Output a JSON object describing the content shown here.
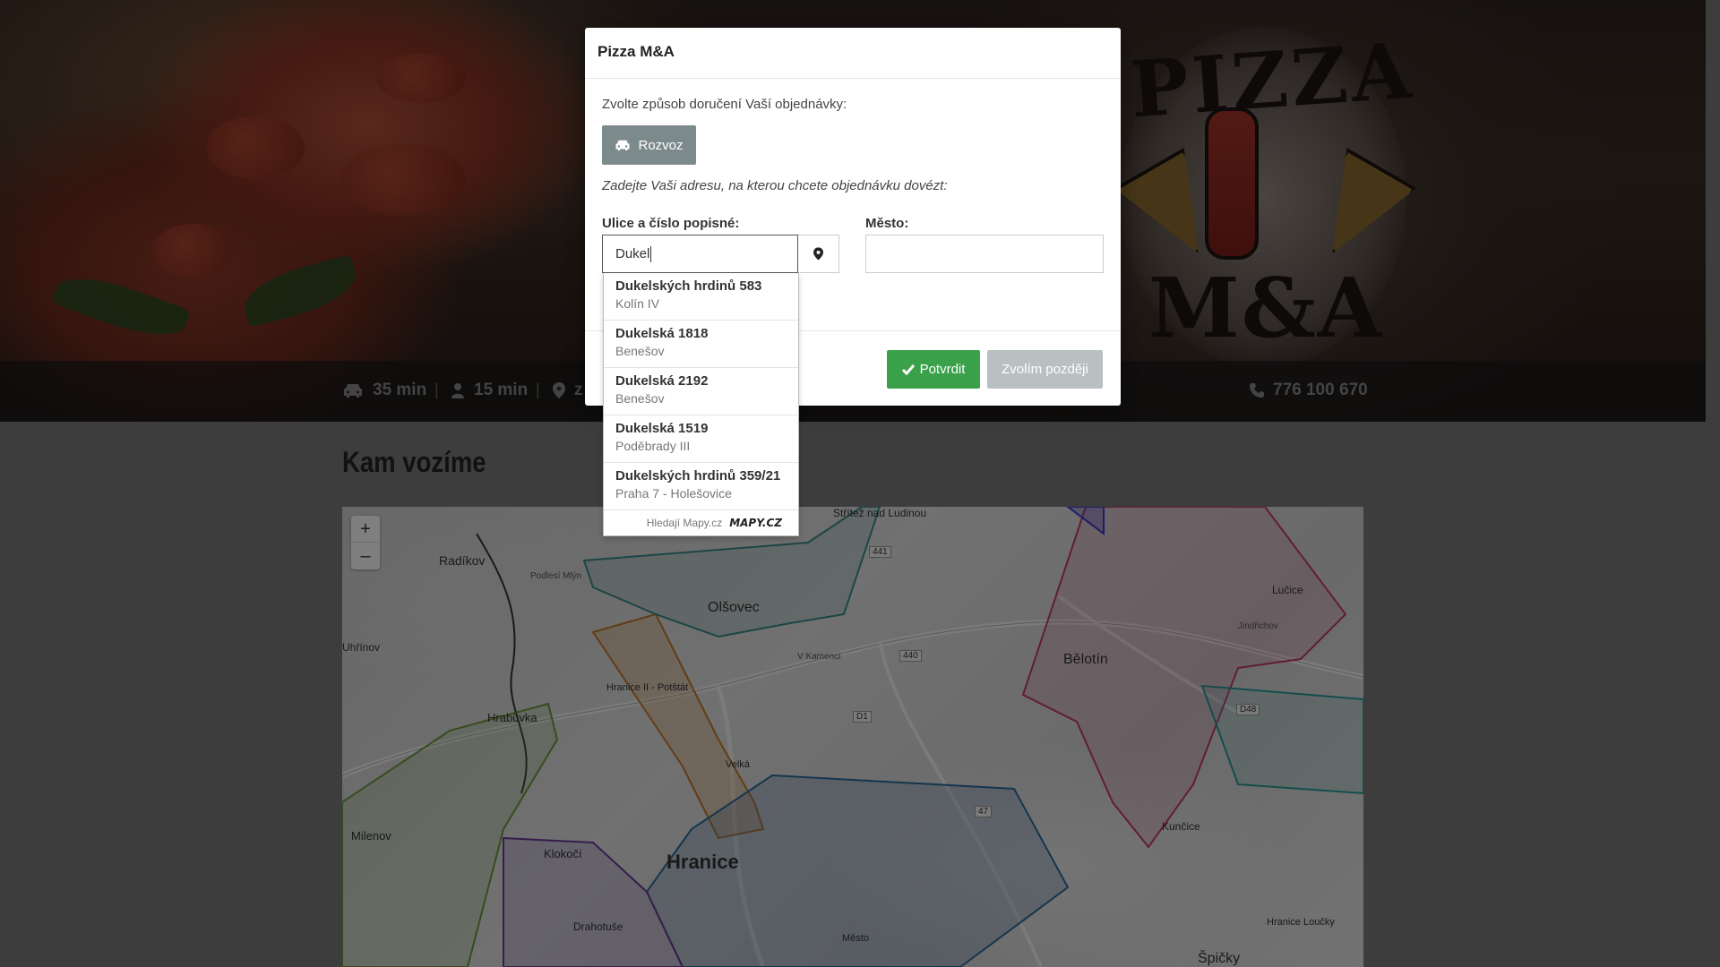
{
  "hero": {
    "logo_top": "PIZZA",
    "logo_bottom": "M&A"
  },
  "info_bar": {
    "delivery_time": "35 min",
    "pickup_time": "15 min",
    "location_partial": "z",
    "phone": "776 100 670"
  },
  "section": {
    "title": "Kam vozíme"
  },
  "map": {
    "zoom_in": "+",
    "zoom_out": "–",
    "places": [
      "Radíkov",
      "Olšovec",
      "Bělotín",
      "Hrabůvka",
      "Hranice",
      "Milenov",
      "Klokočí",
      "Drahotuše",
      "Uhřínov",
      "Lučice",
      "Kunčice",
      "Špičky",
      "Střítež nad Ludinou",
      "Hranice II - Potštát",
      "Velká",
      "Město",
      "Hranice Loučky",
      "Podlesí Mlýn",
      "Jindřichov",
      "V Kamenci"
    ],
    "road_labels": [
      "D1",
      "441",
      "47",
      "D48",
      "440"
    ]
  },
  "modal": {
    "title": "Pizza M&A",
    "delivery_prompt": "Zvolte způsob doručení Vaší objednávky:",
    "delivery_button": "Rozvoz",
    "address_hint": "Zadejte Vaši adresu, na kterou chcete objednávku dovézt:",
    "street_label": "Ulice a číslo popisné:",
    "street_value": "Dukel",
    "city_label": "Město:",
    "city_value": "",
    "confirm_button": "Potvrdit",
    "later_button": "Zvolím později"
  },
  "autocomplete": {
    "items": [
      {
        "title": "Dukelských hrdinů 583",
        "subtitle": "Kolín IV"
      },
      {
        "title": "Dukelská 1818",
        "subtitle": "Benešov"
      },
      {
        "title": "Dukelská 2192",
        "subtitle": "Benešov"
      },
      {
        "title": "Dukelská 1519",
        "subtitle": "Poděbrady III"
      },
      {
        "title": "Dukelských hrdinů 359/21",
        "subtitle": "Praha 7 - Holešovice"
      }
    ],
    "footer_text": "Hledají Mapy.cz",
    "footer_logo": "MAPY.CZ"
  },
  "colors": {
    "confirm": "#3aa14a",
    "delivery_button": "#7d8a8c",
    "later_button": "#b8c0c2"
  }
}
